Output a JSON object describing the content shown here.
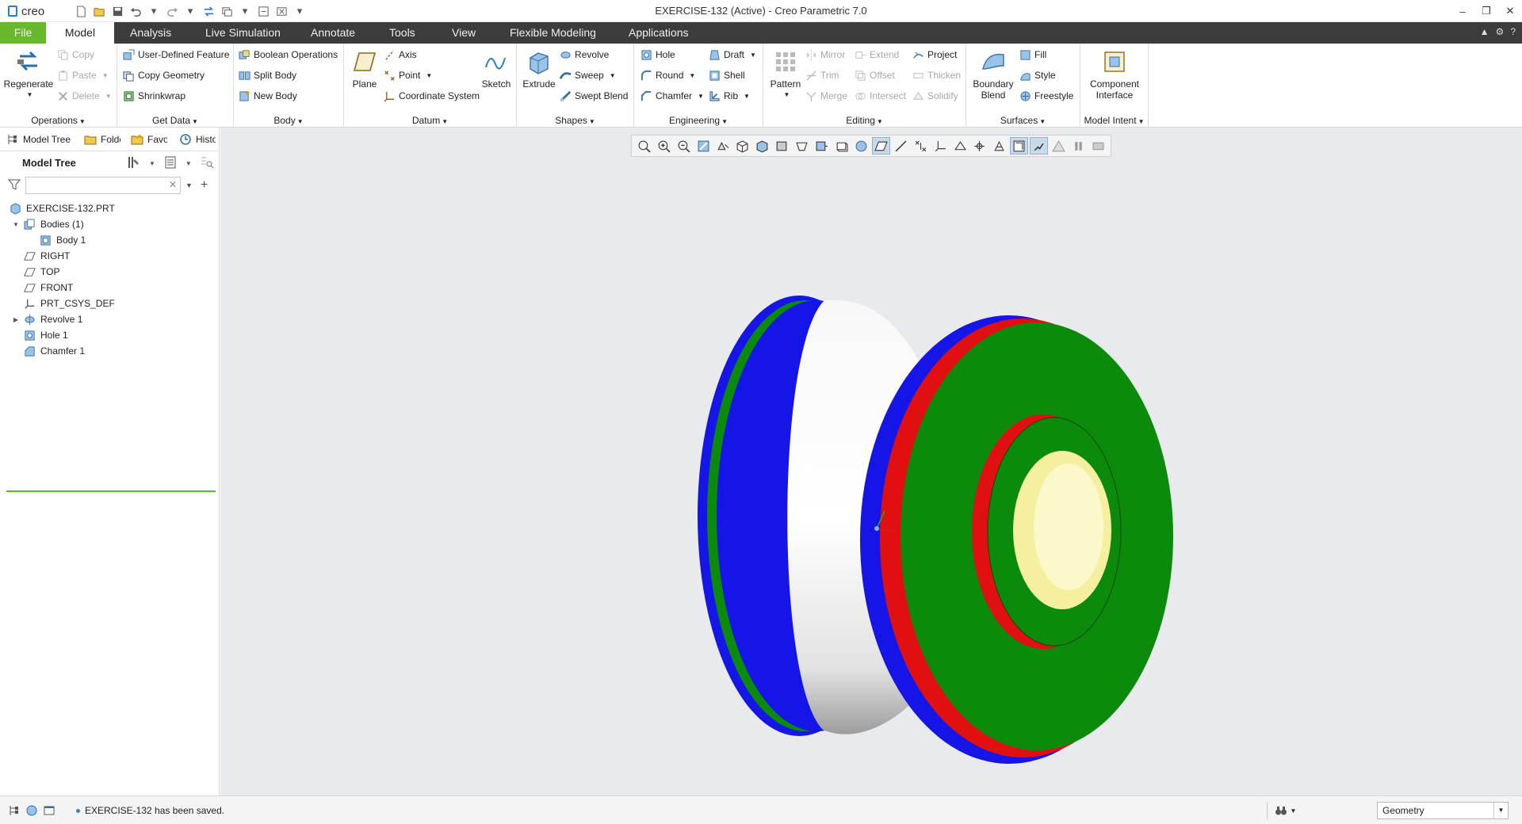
{
  "app": {
    "logo_text": "creo",
    "title": "EXERCISE-132 (Active) - Creo Parametric 7.0",
    "win_min": "–",
    "win_restore": "❐",
    "win_close": "✕"
  },
  "menu": {
    "tabs": [
      "File",
      "Model",
      "Analysis",
      "Live Simulation",
      "Annotate",
      "Tools",
      "View",
      "Flexible Modeling",
      "Applications"
    ],
    "right": [
      "▲",
      "⚙",
      "?"
    ]
  },
  "ribbon": {
    "operations": {
      "label": "Operations",
      "regenerate": "Regenerate",
      "copy": "Copy",
      "paste": "Paste",
      "delete": "Delete"
    },
    "get_data": {
      "label": "Get Data",
      "udf": "User-Defined Feature",
      "copy_geometry": "Copy Geometry",
      "shrinkwrap": "Shrinkwrap"
    },
    "body": {
      "label": "Body",
      "boolean": "Boolean Operations",
      "split": "Split Body",
      "new": "New Body"
    },
    "datum": {
      "label": "Datum",
      "plane": "Plane",
      "axis": "Axis",
      "point": "Point",
      "csys": "Coordinate System",
      "sketch": "Sketch"
    },
    "shapes": {
      "label": "Shapes",
      "extrude": "Extrude",
      "revolve": "Revolve",
      "sweep": "Sweep",
      "swept_blend": "Swept Blend"
    },
    "engineering": {
      "label": "Engineering",
      "hole": "Hole",
      "round": "Round",
      "chamfer": "Chamfer",
      "draft": "Draft",
      "shell": "Shell",
      "rib": "Rib"
    },
    "editing": {
      "label": "Editing",
      "pattern": "Pattern",
      "mirror": "Mirror",
      "trim": "Trim",
      "merge": "Merge",
      "extend": "Extend",
      "offset": "Offset",
      "intersect": "Intersect",
      "project": "Project",
      "thicken": "Thicken",
      "solidify": "Solidify"
    },
    "surfaces": {
      "label": "Surfaces",
      "boundary_1": "Boundary",
      "boundary_2": "Blend",
      "fill": "Fill",
      "style": "Style",
      "freestyle": "Freestyle"
    },
    "model_intent": {
      "label": "Model Intent",
      "component_1": "Component",
      "component_2": "Interface"
    }
  },
  "left_panel": {
    "tabs": [
      "Model Tree",
      "Folder Browser",
      "Favorites",
      "History"
    ],
    "title": "Model Tree",
    "search": {
      "value": "",
      "placeholder": ""
    },
    "items": [
      {
        "label": "EXERCISE-132.PRT",
        "icon": "part-icon",
        "expander": ""
      },
      {
        "label": "Bodies (1)",
        "icon": "bodies-icon",
        "expander": "▼"
      },
      {
        "label": "Body 1",
        "icon": "body-icon",
        "expander": ""
      },
      {
        "label": "RIGHT",
        "icon": "datum-plane-icon",
        "expander": ""
      },
      {
        "label": "TOP",
        "icon": "datum-plane-icon",
        "expander": ""
      },
      {
        "label": "FRONT",
        "icon": "datum-plane-icon",
        "expander": ""
      },
      {
        "label": "PRT_CSYS_DEF",
        "icon": "csys-icon",
        "expander": ""
      },
      {
        "label": "Revolve 1",
        "icon": "revolve-icon",
        "expander": "▶"
      },
      {
        "label": "Hole 1",
        "icon": "hole-icon",
        "expander": ""
      },
      {
        "label": "Chamfer 1",
        "icon": "chamfer-icon",
        "expander": ""
      }
    ]
  },
  "graphics_toolbar": {
    "icons": [
      "refit-icon",
      "zoom-in-icon",
      "zoom-out-icon",
      "repaint-icon",
      "spin-center-icon",
      "saved-orientations-icon",
      "named-views-icon",
      "display-style-icon",
      "perspective-icon",
      "section-icon",
      "appearance-icon",
      "datum-display-icon",
      "planes-display-icon",
      "axes-display-icon",
      "points-display-icon",
      "csys-display-icon",
      "annotation-display-icon",
      "spin-center-display-icon",
      "bodies-display-icon",
      "annotation-plane-icon",
      "pause-icon",
      "regen-preview-icon"
    ]
  },
  "model_colors": {
    "flange_blue": "#1515e8",
    "chamfer_red": "#e01010",
    "face_green": "#0c8a0c",
    "hole_yellow": "#f5f0a0",
    "body_white": "#f2f2f2"
  },
  "status": {
    "message": "EXERCISE-132 has been saved.",
    "filter": "Geometry"
  }
}
